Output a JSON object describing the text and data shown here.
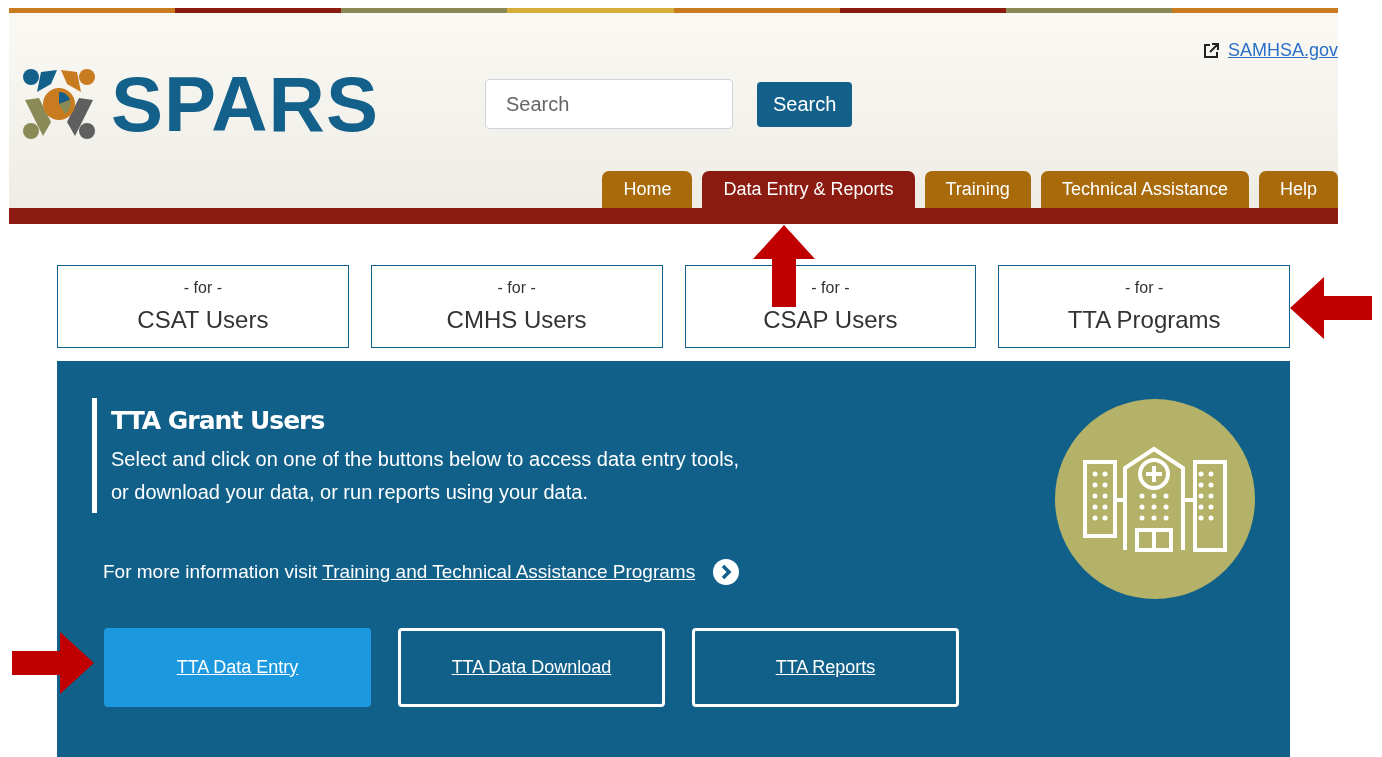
{
  "header": {
    "logo_text": "SPARS",
    "external_link": "SAMHSA.gov",
    "search": {
      "placeholder": "Search",
      "button": "Search"
    }
  },
  "nav_tabs": [
    {
      "label": "Home",
      "selected": false
    },
    {
      "label": "Data Entry & Reports",
      "selected": true
    },
    {
      "label": "Training",
      "selected": false
    },
    {
      "label": "Technical Assistance",
      "selected": false
    },
    {
      "label": "Help",
      "selected": false
    }
  ],
  "user_cards": [
    {
      "prefix": "- for -",
      "label": "CSAT Users"
    },
    {
      "prefix": "- for -",
      "label": "CMHS Users"
    },
    {
      "prefix": "- for -",
      "label": "CSAP Users"
    },
    {
      "prefix": "- for -",
      "label": "TTA Programs"
    }
  ],
  "panel": {
    "title": "TTA Grant Users",
    "description": "Select and click on one of the buttons below to access data entry tools,\nor download your data, or run reports using your data.",
    "info_text": "For more information visit",
    "info_link": "Training and Technical Assistance Programs",
    "actions": [
      {
        "label": "TTA Data Entry",
        "selected": true
      },
      {
        "label": "TTA Data Download",
        "selected": false
      },
      {
        "label": "TTA Reports",
        "selected": false
      }
    ]
  }
}
